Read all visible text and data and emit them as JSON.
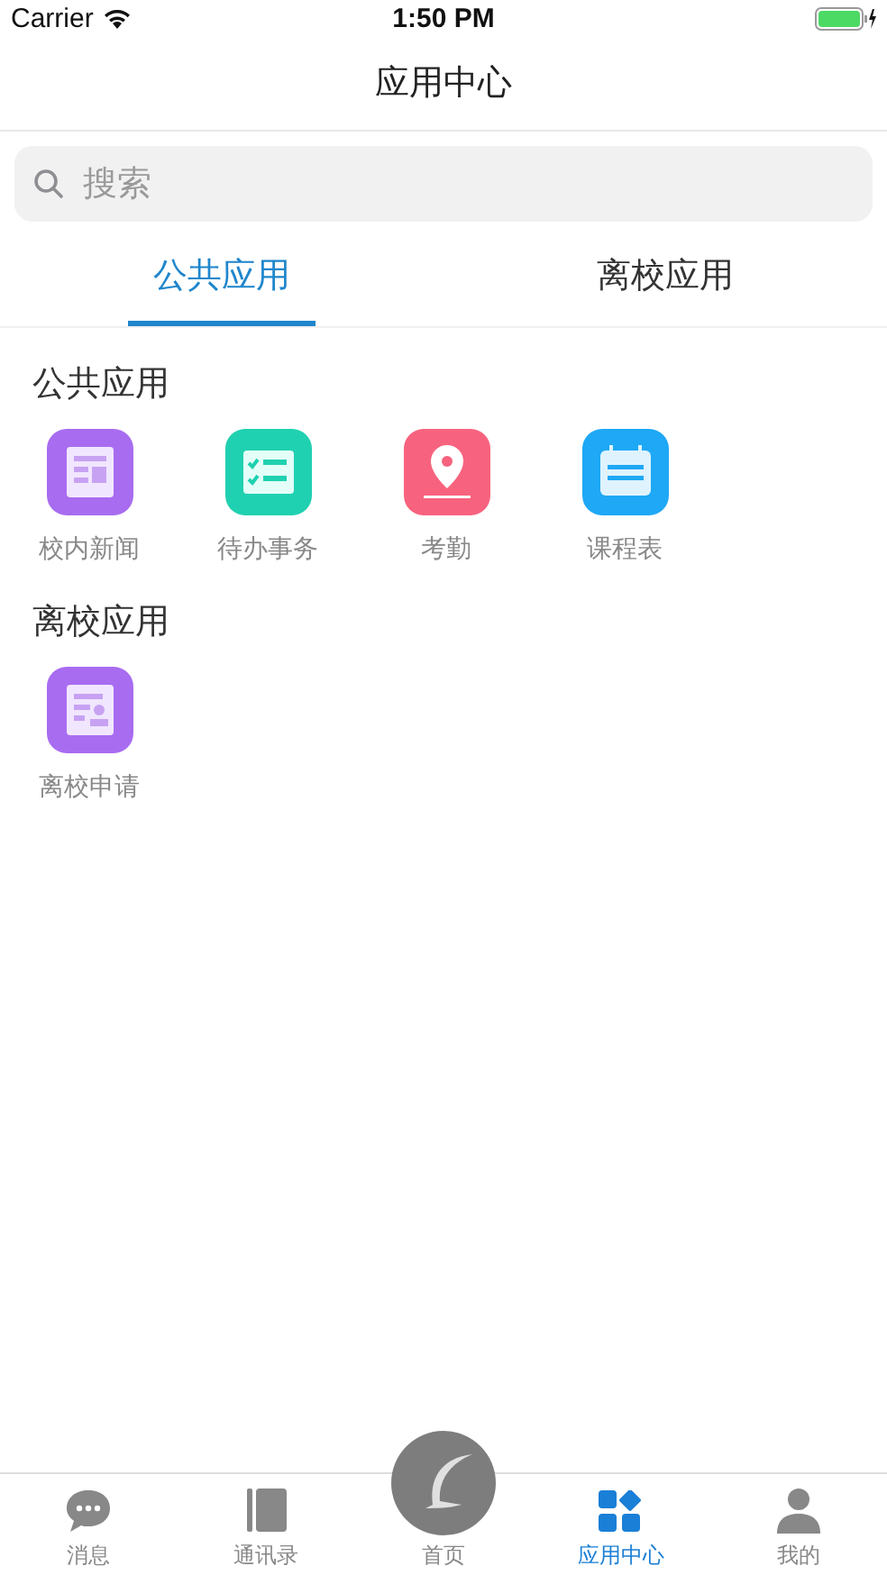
{
  "status_bar": {
    "carrier": "Carrier",
    "time": "1:50 PM"
  },
  "nav": {
    "title": "应用中心"
  },
  "search": {
    "placeholder": "搜索"
  },
  "tabs": [
    {
      "label": "公共应用",
      "selected": true
    },
    {
      "label": "离校应用",
      "selected": false
    }
  ],
  "sections": [
    {
      "title": "公共应用",
      "apps": [
        {
          "label": "校内新闻",
          "kind": "news",
          "color": "#a86cf0"
        },
        {
          "label": "待办事务",
          "kind": "todo",
          "color": "#1fd1b0"
        },
        {
          "label": "考勤",
          "kind": "location",
          "color": "#f7637e"
        },
        {
          "label": "课程表",
          "kind": "calendar",
          "color": "#1ea8f5"
        }
      ]
    },
    {
      "title": "离校应用",
      "apps": [
        {
          "label": "离校申请",
          "kind": "form",
          "color": "#a86cf0"
        }
      ]
    }
  ],
  "tab_bar": [
    {
      "label": "消息",
      "kind": "chat",
      "selected": false
    },
    {
      "label": "通讯录",
      "kind": "book",
      "selected": false
    },
    {
      "label": "首页",
      "kind": "home",
      "selected": false
    },
    {
      "label": "应用中心",
      "kind": "apps",
      "selected": true
    },
    {
      "label": "我的",
      "kind": "person",
      "selected": false
    }
  ]
}
